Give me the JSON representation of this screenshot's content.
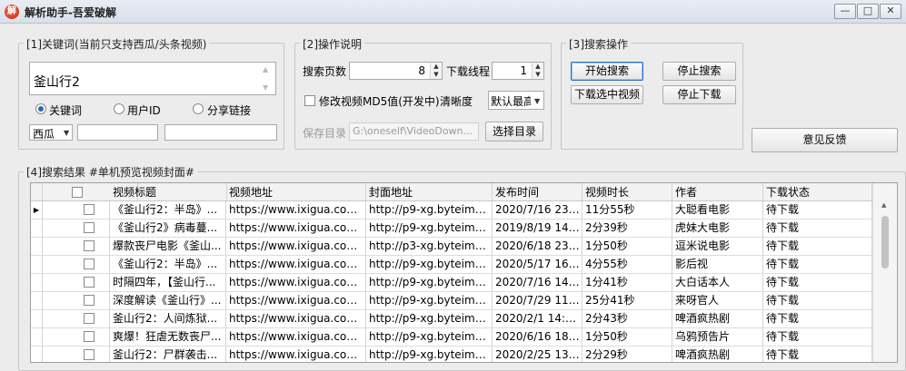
{
  "window": {
    "title": "解析助手-吾爱破解",
    "icon_glyph": "解",
    "minimize": "—",
    "maximize": "□",
    "close": "✕"
  },
  "keyword_group": {
    "legend": "[1]关键词(当前只支持西瓜/头条视频)",
    "keyword_value": "釜山行2",
    "radios": [
      {
        "label": "关键词",
        "checked": true
      },
      {
        "label": "用户ID",
        "checked": false
      },
      {
        "label": "分享链接",
        "checked": false
      }
    ],
    "source_select": "西瓜"
  },
  "operation_group": {
    "legend": "[2]操作说明",
    "pages_label": "搜索页数",
    "pages_value": "8",
    "threads_label": "下载线程",
    "threads_value": "1",
    "md5_label": "修改视频MD5值(开发中)",
    "clarity_label": "清晰度",
    "clarity_value": "默认最高",
    "save_dir_label": "保存目录",
    "save_dir_value": "G:\\oneself\\VideoDown...",
    "choose_dir_button": "选择目录"
  },
  "search_group": {
    "legend": "[3]搜索操作",
    "start_button": "开始搜索",
    "stop_search_button": "停止搜索",
    "download_selected_button": "下载选中视频",
    "stop_download_button": "停止下载"
  },
  "feedback_button": "意见反馈",
  "results_group": {
    "legend": "[4]搜索结果 #单机预览视频封面#",
    "columns": [
      "视频标题",
      "视频地址",
      "封面地址",
      "发布时间",
      "视频时长",
      "作者",
      "下载状态"
    ],
    "rows": [
      [
        "《釜山行2：半岛》...",
        "https://www.ixigua.com/...",
        "http://p9-xg.byteimg.c...",
        "2020/7/16 23:...",
        "11分55秒",
        "大聪看电影",
        "待下载"
      ],
      [
        "《釜山行2》病毒蔓...",
        "https://www.ixigua.com/...",
        "http://p9-xg.byteimg.c...",
        "2019/8/19 14:...",
        "2分39秒",
        "虎妹大电影",
        "待下载"
      ],
      [
        "爆款丧尸电影《釜山...",
        "https://www.ixigua.com/...",
        "http://p3-xg.byteimg.c...",
        "2020/6/18 23:...",
        "1分50秒",
        "逗米说电影",
        "待下载"
      ],
      [
        "《釜山行2：半岛》...",
        "https://www.ixigua.com/...",
        "http://p9-xg.byteimg.c...",
        "2020/5/17 16:...",
        "4分55秒",
        "影后视",
        "待下载"
      ],
      [
        "时隔四年，【釜山行...",
        "https://www.ixigua.com/...",
        "http://p9-xg.byteimg.c...",
        "2020/7/16 14:...",
        "1分41秒",
        "大白话本人",
        "待下载"
      ],
      [
        "深度解读《釜山行》...",
        "https://www.ixigua.com/...",
        "http://p9-xg.byteimg.c...",
        "2020/7/29 11:...",
        "25分41秒",
        "来呀官人",
        "待下载"
      ],
      [
        "釜山行2：人间炼狱...",
        "https://www.ixigua.com/...",
        "http://p9-xg.byteimg.c...",
        "2020/2/1 14:0...",
        "2分43秒",
        "啤酒疯热剧",
        "待下载"
      ],
      [
        "爽爆！狂虐无数丧尸...",
        "https://www.ixigua.com/...",
        "http://p9-xg.byteimg.c...",
        "2020/6/16 18:...",
        "1分50秒",
        "乌鸦预告片",
        "待下载"
      ],
      [
        "釜山行2：尸群袭击...",
        "https://www.ixigua.com/...",
        "http://p9-xg.byteimg.c...",
        "2020/2/25 13:...",
        "2分29秒",
        "啤酒疯热剧",
        "待下载"
      ]
    ],
    "current_row_glyph": "▶"
  }
}
